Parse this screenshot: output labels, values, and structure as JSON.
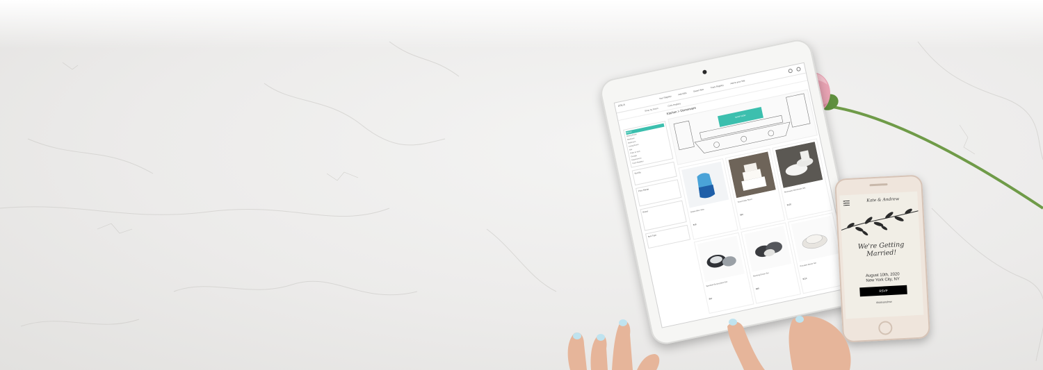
{
  "tablet": {
    "logo": "ZOLA",
    "nav": [
      "Your Registry",
      "Add Gifts",
      "Guest View",
      "Track Registry",
      "Add to your Site"
    ],
    "sub_tabs": [
      "Shop by Room",
      "Cash Registry"
    ],
    "page_title": "Kitchen > Dinnerware",
    "kitchen_cta": "SHOP NOW",
    "sidebar_rooms": [
      "Kitchen",
      "Dining Room",
      "Bedroom",
      "Bathroom",
      "Living Room",
      "Bar",
      "Patio & Yard",
      "Garage",
      "Experiences",
      "Cash Registry"
    ],
    "sidebar_filters": [
      "Sort By",
      "Price Range",
      "Brand",
      "Item Type"
    ],
    "products": [
      {
        "title": "Ombre Blue Vase",
        "price": "$48"
      },
      {
        "title": "Tiered Cake Stand",
        "price": "$95"
      },
      {
        "title": "Stoneware Dinnerware Set",
        "price": "$120"
      },
      {
        "title": "Speckled Serving Bowl Set",
        "price": "$64"
      },
      {
        "title": "Stacking Dinner Set",
        "price": "$88"
      },
      {
        "title": "Porcelain Dinner Set",
        "price": "$110"
      }
    ]
  },
  "phone": {
    "names": "Kate & Andrew",
    "headline": "We're Getting Married!",
    "date": "August 10th, 2020",
    "location": "New York City, NY",
    "rsvp_label": "RSVP",
    "hashtag": "#kateandrew"
  },
  "colors": {
    "accent": "#3cbfae",
    "marble": "#ecebea",
    "rose": "#e9a4b4"
  }
}
